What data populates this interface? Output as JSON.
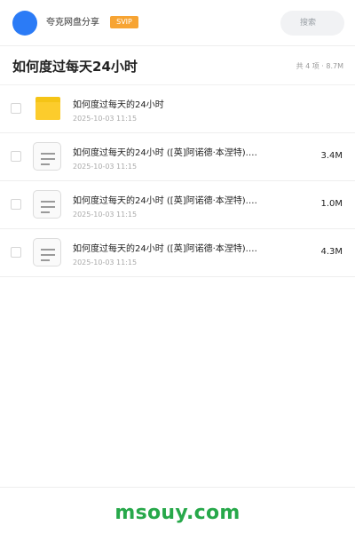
{
  "header": {
    "app_name": "夸克网盘分享",
    "badge": "SVIP",
    "search_placeholder": "搜索"
  },
  "share": {
    "title": "如何度过每天24小时",
    "summary": "共 4 项 · 8.7M"
  },
  "files": [
    {
      "type": "folder",
      "name": "如何度过每天的24小时",
      "date": "2025-10-03 11:15",
      "size": ""
    },
    {
      "type": "document",
      "name": "如何度过每天的24小时 ([英]阿诺德·本涅特).…",
      "date": "2025-10-03 11:15",
      "size": "3.4M"
    },
    {
      "type": "document",
      "name": "如何度过每天的24小时 ([英]阿诺德·本涅特).…",
      "date": "2025-10-03 11:15",
      "size": "1.0M"
    },
    {
      "type": "document",
      "name": "如何度过每天的24小时 ([英]阿诺德·本涅特).…",
      "date": "2025-10-03 11:15",
      "size": "4.3M"
    }
  ],
  "footer": {
    "watermark": "msouy.com"
  },
  "colors": {
    "avatar": "#2b7bf6",
    "badge": "#f7a433",
    "folder": "#fccc2c",
    "watermark": "#27a84a"
  },
  "icons": {
    "folder": "folder-icon",
    "document": "document-icon"
  }
}
